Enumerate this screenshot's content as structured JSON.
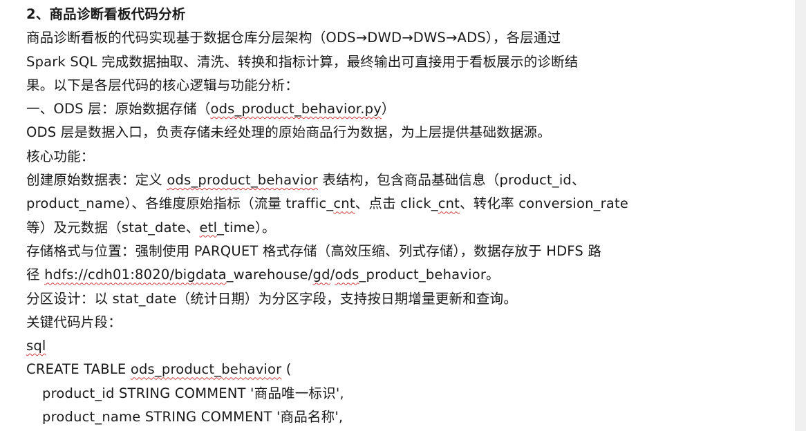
{
  "heading": "2、商品诊断看板代码分析",
  "lines": {
    "p1a": "商品诊断看板的代码实现基于数据仓库分层架构（ODS→DWD→DWS→ADS），各层通过",
    "p1b": "Spark SQL 完成数据抽取、清洗、转换和指标计算，最终输出可直接用于看板展示的诊断结",
    "p1c": "果。以下是各层代码的核心逻辑与功能分析：",
    "ods_title_pre": "一、ODS 层：原始数据存储（",
    "ods_title_file": "ods_product_behavior.py",
    "ods_title_post": "）",
    "ods_desc": "ODS 层是数据入口，负责存储未经处理的原始商品行为数据，为上层提供基础数据源。",
    "core_func": "核心功能：",
    "create_pre": "创建原始数据表：定义 ",
    "create_tbl": "ods_product_behavior",
    "create_post": " 表结构，包含商品基础信息（product_id、",
    "dims_a": "product_name）、各维度原始指标（流量 traffic_",
    "dims_b": "cnt",
    "dims_c": "、点击 click_",
    "dims_d": "cnt",
    "dims_e": "、转化率 conversion_rate",
    "meta_a": "等）及元数据（stat_date、",
    "meta_b": "etl",
    "meta_c": "_time）。",
    "storage_a": "存储格式与位置：强制使用 PARQUET 格式存储（高效压缩、列式存储），数据存放于  HDFS  路",
    "path_a": "径 ",
    "path_b": "hdfs://cdh01:8020/",
    "path_c": "bigdata",
    "path_d": "_warehouse/",
    "path_e": "gd",
    "path_f": "/",
    "path_g": "ods",
    "path_h": "_product_behavior",
    "path_i": "。",
    "partition": "分区设计：以 stat_date（统计日期）为分区字段，支持按日期增量更新和查询。",
    "key_code": "关键代码片段：",
    "sql": "sql",
    "create_stmt_a": "CREATE TABLE ",
    "create_stmt_b": "ods_product_behavior",
    "create_stmt_c": " (",
    "col1": "product_id STRING COMMENT '商品唯一标识',",
    "col2": "product_name STRING COMMENT '商品名称',"
  }
}
